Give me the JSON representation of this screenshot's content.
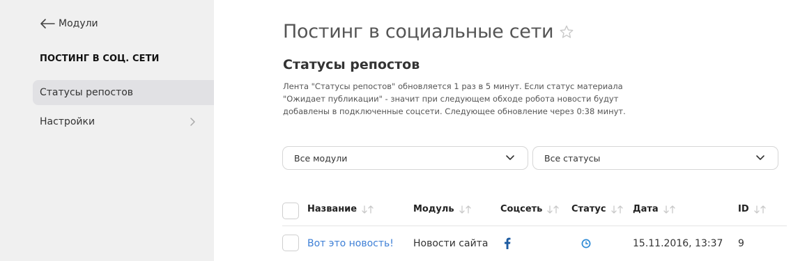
{
  "sidebar": {
    "back_label": "Модули",
    "title": "ПОСТИНГ В СОЦ. СЕТИ",
    "items": [
      {
        "label": "Статусы репостов",
        "active": true
      },
      {
        "label": "Настройки",
        "active": false,
        "has_submenu": true
      }
    ]
  },
  "main": {
    "page_title": "Постинг в социальные сети",
    "section_title": "Статусы репостов",
    "description_lines": [
      "Лента \"Статусы репостов\" обновляется 1 раз в 5 минут. Если статус материала",
      "\"Ожидает публикации\" - значит при следующем обходе робота новости будут",
      "добавлены в подключенные соцсети. Следующее обновление через 0:38 минут."
    ],
    "filters": {
      "module": {
        "value": "Все модули"
      },
      "status": {
        "value": "Все статусы"
      }
    },
    "table": {
      "columns": [
        "Название",
        "Модуль",
        "Соцсеть",
        "Статус",
        "Дата",
        "ID"
      ],
      "rows": [
        {
          "title": "Вот это новость!",
          "module": "Новости сайта",
          "social": "facebook-icon",
          "status": "clock-icon",
          "date": "15.11.2016, 13:37",
          "id": "9"
        }
      ]
    }
  },
  "colors": {
    "sidebar_bg": "#f0f0f0",
    "active_item_bg": "#e1e1e4",
    "link": "#3d7fd6",
    "facebook": "#1c5aa0",
    "status_pending": "#2d8ad6"
  }
}
